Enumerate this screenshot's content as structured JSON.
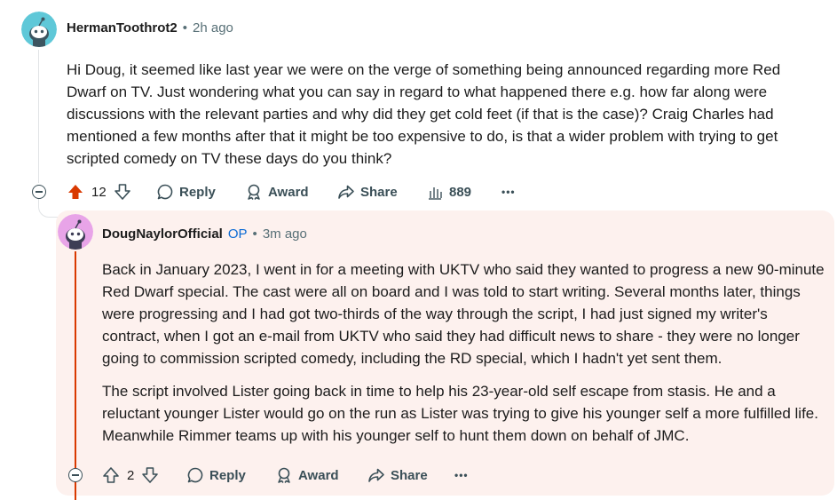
{
  "comment1": {
    "username": "HermanToothrot2",
    "time": "2h ago",
    "body": "Hi Doug, it seemed like last year we were on the verge of something being announced regarding more Red Dwarf on TV. Just wondering what you can say in regard to what happened there e.g. how far along were discussions with the relevant parties and why did they get cold feet (if that is the case)? Craig Charles had mentioned a few months after that it might be too expensive to do, is that a wider problem with trying to get scripted comedy on TV these days do you think?",
    "votes": "12",
    "reply_label": "Reply",
    "award_label": "Award",
    "share_label": "Share",
    "views": "889",
    "more": "•••"
  },
  "comment2": {
    "username": "DougNaylorOfficial",
    "op_badge": "OP",
    "time": "3m ago",
    "para1": "Back in January 2023, I went in for a meeting with UKTV who said they wanted to progress a new 90-minute Red Dwarf special. The cast were all on board and I was told to start writing. Several months later, things were progressing and I had got two-thirds of the way through the script, I had just signed my writer's contract, when I got an e-mail from UKTV who said they had difficult news to share - they were no longer going to commission scripted comedy, including the RD special, which I hadn't yet sent them.",
    "para2": "The script involved Lister going back in time to help his 23-year-old self escape from stasis. He and a reluctant younger Lister would go on the run as Lister was trying to give his younger self a more fulfilled life. Meanwhile Rimmer teams up with his younger self to hunt them down on behalf of JMC.",
    "votes": "2",
    "reply_label": "Reply",
    "award_label": "Award",
    "share_label": "Share",
    "more": "•••"
  },
  "separator": "•",
  "colors": {
    "upvote_active": "#d93900",
    "op": "#0a6ad4",
    "thread_line": "#d93900",
    "highlight_bg": "#fdf1ee"
  }
}
